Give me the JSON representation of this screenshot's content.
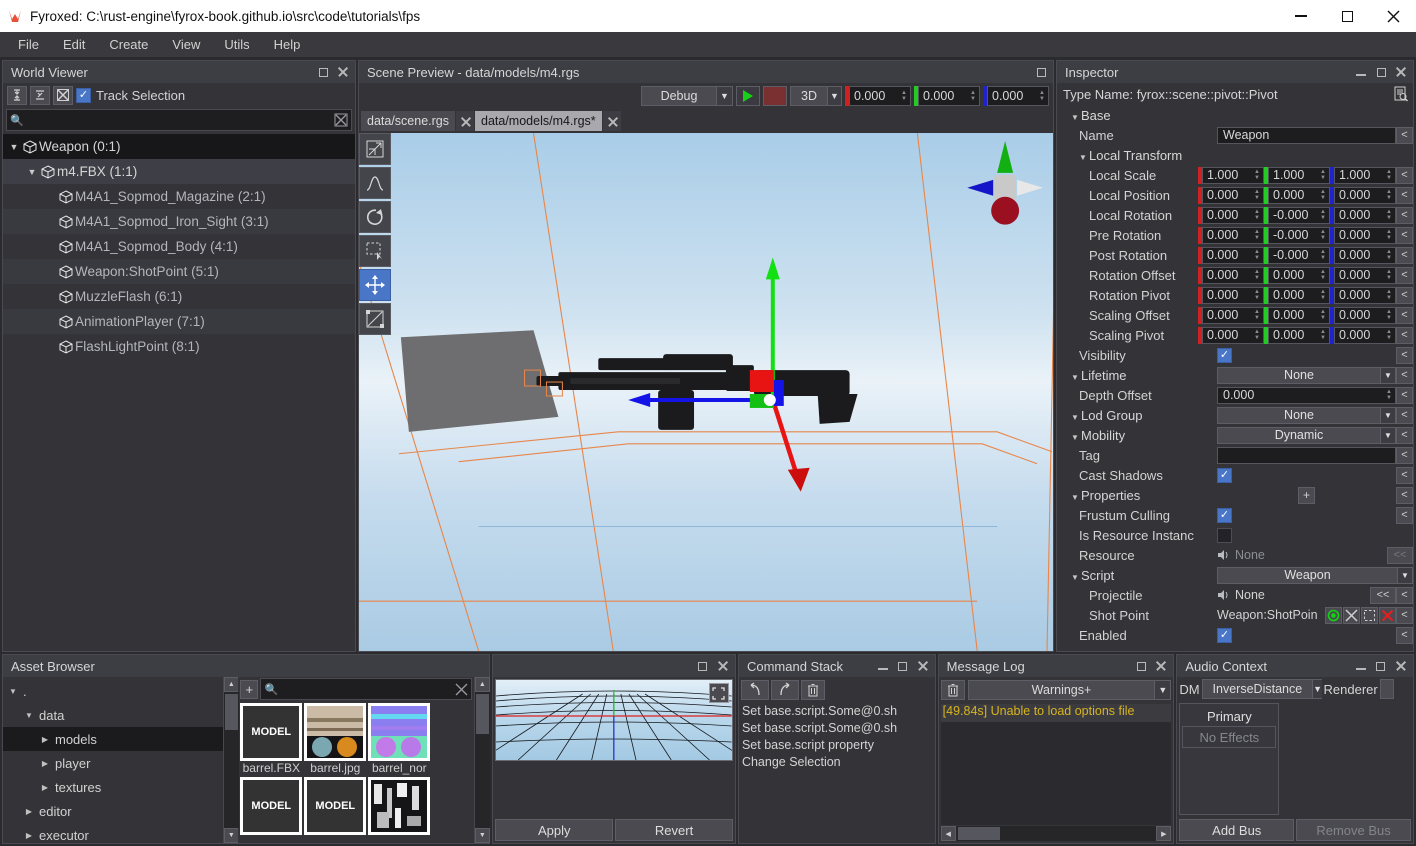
{
  "window": {
    "title": "Fyroxed: C:\\rust-engine\\fyrox-book.github.io\\src\\code\\tutorials\\fps",
    "minimize": "—",
    "maximize": "□",
    "close": "✕"
  },
  "menu": {
    "items": [
      "File",
      "Edit",
      "Create",
      "View",
      "Utils",
      "Help"
    ]
  },
  "world_viewer": {
    "title": "World Viewer",
    "track_selection_label": "Track Selection",
    "track_selection_checked": true,
    "search_value": "",
    "tree": [
      {
        "label": "Weapon (0:1)",
        "depth": 0,
        "expanded": true,
        "state": "selected"
      },
      {
        "label": "m4.FBX (1:1)",
        "depth": 1,
        "expanded": true,
        "state": "highlight"
      },
      {
        "label": "M4A1_Sopmod_Magazine (2:1)",
        "depth": 2,
        "expanded": false,
        "state": "normal"
      },
      {
        "label": "M4A1_Sopmod_Iron_Sight (3:1)",
        "depth": 2,
        "expanded": false,
        "state": "alt"
      },
      {
        "label": "M4A1_Sopmod_Body (4:1)",
        "depth": 2,
        "expanded": false,
        "state": "normal"
      },
      {
        "label": "Weapon:ShotPoint (5:1)",
        "depth": 2,
        "expanded": false,
        "state": "alt"
      },
      {
        "label": "MuzzleFlash (6:1)",
        "depth": 2,
        "expanded": false,
        "state": "normal"
      },
      {
        "label": "AnimationPlayer (7:1)",
        "depth": 2,
        "expanded": false,
        "state": "alt"
      },
      {
        "label": "FlashLightPoint (8:1)",
        "depth": 2,
        "expanded": false,
        "state": "normal"
      }
    ]
  },
  "scene_preview": {
    "title": "Scene Preview - data/models/m4.rgs",
    "mode_combo": "Debug",
    "view_combo": "3D",
    "coords": [
      {
        "axis": "x",
        "color": "#cc2222",
        "value": "0.000"
      },
      {
        "axis": "y",
        "color": "#22cc22",
        "value": "0.000"
      },
      {
        "axis": "z",
        "color": "#2222cc",
        "value": "0.000"
      }
    ],
    "tabs": [
      {
        "label": "data/scene.rgs",
        "active": false
      },
      {
        "label": "data/models/m4.rgs*",
        "active": true
      }
    ],
    "tools": [
      {
        "name": "select-tool",
        "active": false
      },
      {
        "name": "terrain-tool",
        "active": false
      },
      {
        "name": "rotate-tool",
        "active": false
      },
      {
        "name": "rect-select-tool",
        "active": false
      },
      {
        "name": "move-tool",
        "active": true
      },
      {
        "name": "scale-tool",
        "active": false
      }
    ]
  },
  "inspector": {
    "title": "Inspector",
    "type_name": "Type Name: fyrox::scene::pivot::Pivot",
    "revert_label": "<",
    "double_revert_label": "<<",
    "sections": [
      {
        "kind": "header",
        "label": "Base",
        "indent": 0
      },
      {
        "kind": "text",
        "label": "Name",
        "indent": 1,
        "value": "Weapon"
      },
      {
        "kind": "header",
        "label": "Local Transform",
        "indent": 1
      },
      {
        "kind": "vec3",
        "label": "Local Scale",
        "indent": 2,
        "values": [
          "1.000",
          "1.000",
          "1.000"
        ]
      },
      {
        "kind": "vec3",
        "label": "Local Position",
        "indent": 2,
        "values": [
          "0.000",
          "0.000",
          "0.000"
        ]
      },
      {
        "kind": "vec3",
        "label": "Local Rotation",
        "indent": 2,
        "values": [
          "0.000",
          "-0.000",
          "0.000"
        ]
      },
      {
        "kind": "vec3",
        "label": "Pre Rotation",
        "indent": 2,
        "values": [
          "0.000",
          "-0.000",
          "0.000"
        ]
      },
      {
        "kind": "vec3",
        "label": "Post Rotation",
        "indent": 2,
        "values": [
          "0.000",
          "-0.000",
          "0.000"
        ]
      },
      {
        "kind": "vec3",
        "label": "Rotation Offset",
        "indent": 2,
        "values": [
          "0.000",
          "0.000",
          "0.000"
        ]
      },
      {
        "kind": "vec3",
        "label": "Rotation Pivot",
        "indent": 2,
        "values": [
          "0.000",
          "0.000",
          "0.000"
        ]
      },
      {
        "kind": "vec3",
        "label": "Scaling Offset",
        "indent": 2,
        "values": [
          "0.000",
          "0.000",
          "0.000"
        ]
      },
      {
        "kind": "vec3",
        "label": "Scaling Pivot",
        "indent": 2,
        "values": [
          "0.000",
          "0.000",
          "0.000"
        ]
      },
      {
        "kind": "check",
        "label": "Visibility",
        "indent": 1,
        "checked": true
      },
      {
        "kind": "combo",
        "label": "Lifetime",
        "indent": 0,
        "header": true,
        "value": "None"
      },
      {
        "kind": "num",
        "label": "Depth Offset",
        "indent": 1,
        "value": "0.000"
      },
      {
        "kind": "combo",
        "label": "Lod Group",
        "indent": 0,
        "header": true,
        "value": "None"
      },
      {
        "kind": "combo",
        "label": "Mobility",
        "indent": 0,
        "header": true,
        "value": "Dynamic"
      },
      {
        "kind": "text",
        "label": "Tag",
        "indent": 1,
        "value": ""
      },
      {
        "kind": "check",
        "label": "Cast Shadows",
        "indent": 1,
        "checked": true
      },
      {
        "kind": "header_plus",
        "label": "Properties",
        "indent": 0
      },
      {
        "kind": "check",
        "label": "Frustum Culling",
        "indent": 1,
        "checked": true
      },
      {
        "kind": "check_norevert",
        "label": "Is Resource Instanc",
        "indent": 1,
        "checked": false
      },
      {
        "kind": "resource",
        "label": "Resource",
        "indent": 1,
        "value": "None"
      },
      {
        "kind": "combo_noarrowrev",
        "label": "Script",
        "indent": 0,
        "header": true,
        "value": "Weapon"
      },
      {
        "kind": "resource_dbl",
        "label": "Projectile",
        "indent": 2,
        "value": "None"
      },
      {
        "kind": "node_ref",
        "label": "Shot Point",
        "indent": 2,
        "value": "Weapon:ShotPoin"
      },
      {
        "kind": "check",
        "label": "Enabled",
        "indent": 1,
        "checked": true
      }
    ]
  },
  "asset_browser": {
    "title": "Asset Browser",
    "search_value": "",
    "add_label": "+",
    "tree": [
      {
        "label": ".",
        "depth": 0,
        "expanded": true,
        "selected": false
      },
      {
        "label": "data",
        "depth": 1,
        "expanded": true,
        "selected": false
      },
      {
        "label": "models",
        "depth": 2,
        "expanded": false,
        "selected": true
      },
      {
        "label": "player",
        "depth": 2,
        "expanded": false,
        "selected": false
      },
      {
        "label": "textures",
        "depth": 2,
        "expanded": false,
        "selected": false
      },
      {
        "label": "editor",
        "depth": 1,
        "expanded": false,
        "selected": false
      },
      {
        "label": "executor",
        "depth": 1,
        "expanded": false,
        "selected": false
      }
    ],
    "assets": [
      {
        "name": "barrel.FBX",
        "kind": "MODEL"
      },
      {
        "name": "barrel.jpg",
        "kind": "IMAGE"
      },
      {
        "name": "barrel_nor",
        "kind": "NORMAL"
      },
      {
        "name": "",
        "kind": "MODEL"
      },
      {
        "name": "",
        "kind": "MODEL"
      },
      {
        "name": "",
        "kind": "GRAY"
      }
    ]
  },
  "preview_panel": {
    "apply_label": "Apply",
    "revert_label": "Revert"
  },
  "command_stack": {
    "title": "Command Stack",
    "items": [
      "Set base.script.Some@0.sh",
      "Set base.script.Some@0.sh",
      "Set base.script property",
      "Change Selection"
    ]
  },
  "message_log": {
    "title": "Message Log",
    "filter": "Warnings+",
    "messages": [
      "[49.84s] Unable to load options file"
    ]
  },
  "audio_context": {
    "title": "Audio Context",
    "dm_label": "DM",
    "distance_model": "InverseDistance",
    "renderer_label": "Renderer",
    "bus_name": "Primary",
    "no_effects": "No Effects",
    "add_bus": "Add Bus",
    "remove_bus": "Remove Bus"
  },
  "colors": {
    "accent_blue": "#4a76c8",
    "axis_x": "#cc2222",
    "axis_y": "#22cc22",
    "axis_z": "#2222cc",
    "warning": "#d8b41e",
    "wireframe": "#e8864a"
  }
}
